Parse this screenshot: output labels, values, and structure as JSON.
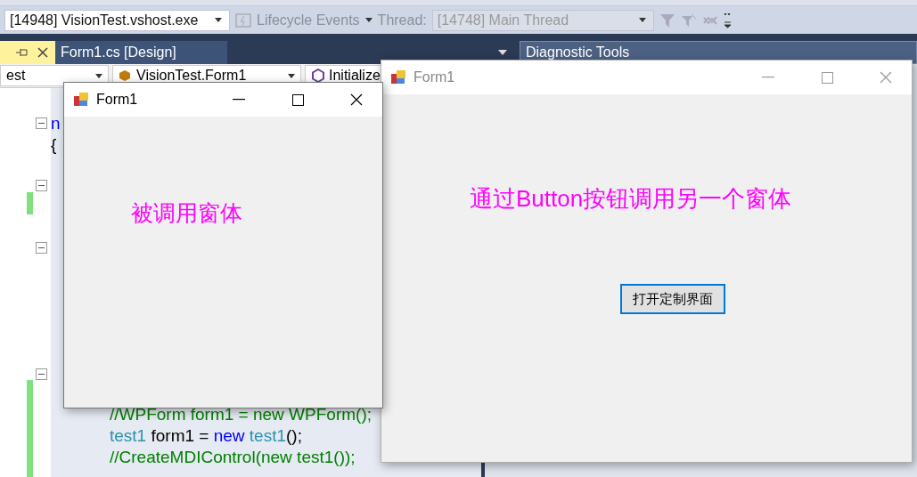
{
  "toolbar": {
    "process": "[14948] VisionTest.vshost.exe",
    "lifecycle": "Lifecycle Events",
    "thread_label": "Thread:",
    "thread": "[14748] Main Thread"
  },
  "document_tab": {
    "label": "Form1.cs [Design]"
  },
  "diagnostic_panel": {
    "title": "Diagnostic Tools"
  },
  "nav_bar": [
    "est",
    "VisionTest.Form1",
    "Initialize"
  ],
  "code_top": [
    {
      "parts": [
        {
          "text": "n",
          "kind": "keyword"
        }
      ]
    },
    {
      "parts": [
        {
          "text": "{",
          "kind": "plain"
        }
      ]
    }
  ],
  "code_bottom": [
    {
      "parts": [
        {
          "text": "//WPForm form1 = new WPForm();",
          "kind": "comment"
        }
      ]
    },
    {
      "parts": [
        {
          "text": "test1",
          "kind": "type"
        },
        {
          "text": " form1 = ",
          "kind": "plain"
        },
        {
          "text": "new",
          "kind": "keyword"
        },
        {
          "text": " test1",
          "kind": "type"
        },
        {
          "text": "();",
          "kind": "plain"
        }
      ]
    },
    {
      "parts": [
        {
          "text": "//CreateMDIControl(new test1());",
          "kind": "comment"
        }
      ]
    }
  ],
  "windows": [
    {
      "title": "Form1",
      "active": true,
      "message": "被调用窗体"
    },
    {
      "title": "Form1",
      "active": false,
      "message": "通过Button按钮调用另一个窗体",
      "button": {
        "label": "打开定制界面",
        "focused": true
      }
    }
  ]
}
